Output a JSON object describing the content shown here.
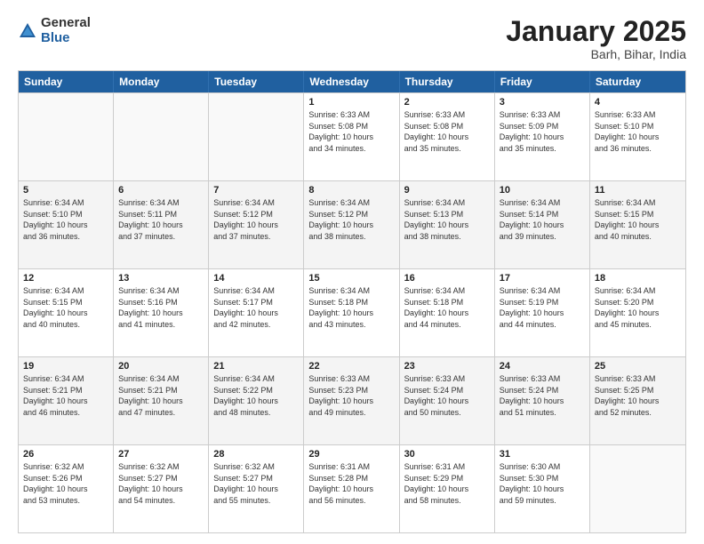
{
  "logo": {
    "general": "General",
    "blue": "Blue"
  },
  "header": {
    "title": "January 2025",
    "location": "Barh, Bihar, India"
  },
  "weekdays": [
    "Sunday",
    "Monday",
    "Tuesday",
    "Wednesday",
    "Thursday",
    "Friday",
    "Saturday"
  ],
  "weeks": [
    [
      {
        "day": "",
        "info": ""
      },
      {
        "day": "",
        "info": ""
      },
      {
        "day": "",
        "info": ""
      },
      {
        "day": "1",
        "info": "Sunrise: 6:33 AM\nSunset: 5:08 PM\nDaylight: 10 hours\nand 34 minutes."
      },
      {
        "day": "2",
        "info": "Sunrise: 6:33 AM\nSunset: 5:08 PM\nDaylight: 10 hours\nand 35 minutes."
      },
      {
        "day": "3",
        "info": "Sunrise: 6:33 AM\nSunset: 5:09 PM\nDaylight: 10 hours\nand 35 minutes."
      },
      {
        "day": "4",
        "info": "Sunrise: 6:33 AM\nSunset: 5:10 PM\nDaylight: 10 hours\nand 36 minutes."
      }
    ],
    [
      {
        "day": "5",
        "info": "Sunrise: 6:34 AM\nSunset: 5:10 PM\nDaylight: 10 hours\nand 36 minutes."
      },
      {
        "day": "6",
        "info": "Sunrise: 6:34 AM\nSunset: 5:11 PM\nDaylight: 10 hours\nand 37 minutes."
      },
      {
        "day": "7",
        "info": "Sunrise: 6:34 AM\nSunset: 5:12 PM\nDaylight: 10 hours\nand 37 minutes."
      },
      {
        "day": "8",
        "info": "Sunrise: 6:34 AM\nSunset: 5:12 PM\nDaylight: 10 hours\nand 38 minutes."
      },
      {
        "day": "9",
        "info": "Sunrise: 6:34 AM\nSunset: 5:13 PM\nDaylight: 10 hours\nand 38 minutes."
      },
      {
        "day": "10",
        "info": "Sunrise: 6:34 AM\nSunset: 5:14 PM\nDaylight: 10 hours\nand 39 minutes."
      },
      {
        "day": "11",
        "info": "Sunrise: 6:34 AM\nSunset: 5:15 PM\nDaylight: 10 hours\nand 40 minutes."
      }
    ],
    [
      {
        "day": "12",
        "info": "Sunrise: 6:34 AM\nSunset: 5:15 PM\nDaylight: 10 hours\nand 40 minutes."
      },
      {
        "day": "13",
        "info": "Sunrise: 6:34 AM\nSunset: 5:16 PM\nDaylight: 10 hours\nand 41 minutes."
      },
      {
        "day": "14",
        "info": "Sunrise: 6:34 AM\nSunset: 5:17 PM\nDaylight: 10 hours\nand 42 minutes."
      },
      {
        "day": "15",
        "info": "Sunrise: 6:34 AM\nSunset: 5:18 PM\nDaylight: 10 hours\nand 43 minutes."
      },
      {
        "day": "16",
        "info": "Sunrise: 6:34 AM\nSunset: 5:18 PM\nDaylight: 10 hours\nand 44 minutes."
      },
      {
        "day": "17",
        "info": "Sunrise: 6:34 AM\nSunset: 5:19 PM\nDaylight: 10 hours\nand 44 minutes."
      },
      {
        "day": "18",
        "info": "Sunrise: 6:34 AM\nSunset: 5:20 PM\nDaylight: 10 hours\nand 45 minutes."
      }
    ],
    [
      {
        "day": "19",
        "info": "Sunrise: 6:34 AM\nSunset: 5:21 PM\nDaylight: 10 hours\nand 46 minutes."
      },
      {
        "day": "20",
        "info": "Sunrise: 6:34 AM\nSunset: 5:21 PM\nDaylight: 10 hours\nand 47 minutes."
      },
      {
        "day": "21",
        "info": "Sunrise: 6:34 AM\nSunset: 5:22 PM\nDaylight: 10 hours\nand 48 minutes."
      },
      {
        "day": "22",
        "info": "Sunrise: 6:33 AM\nSunset: 5:23 PM\nDaylight: 10 hours\nand 49 minutes."
      },
      {
        "day": "23",
        "info": "Sunrise: 6:33 AM\nSunset: 5:24 PM\nDaylight: 10 hours\nand 50 minutes."
      },
      {
        "day": "24",
        "info": "Sunrise: 6:33 AM\nSunset: 5:24 PM\nDaylight: 10 hours\nand 51 minutes."
      },
      {
        "day": "25",
        "info": "Sunrise: 6:33 AM\nSunset: 5:25 PM\nDaylight: 10 hours\nand 52 minutes."
      }
    ],
    [
      {
        "day": "26",
        "info": "Sunrise: 6:32 AM\nSunset: 5:26 PM\nDaylight: 10 hours\nand 53 minutes."
      },
      {
        "day": "27",
        "info": "Sunrise: 6:32 AM\nSunset: 5:27 PM\nDaylight: 10 hours\nand 54 minutes."
      },
      {
        "day": "28",
        "info": "Sunrise: 6:32 AM\nSunset: 5:27 PM\nDaylight: 10 hours\nand 55 minutes."
      },
      {
        "day": "29",
        "info": "Sunrise: 6:31 AM\nSunset: 5:28 PM\nDaylight: 10 hours\nand 56 minutes."
      },
      {
        "day": "30",
        "info": "Sunrise: 6:31 AM\nSunset: 5:29 PM\nDaylight: 10 hours\nand 58 minutes."
      },
      {
        "day": "31",
        "info": "Sunrise: 6:30 AM\nSunset: 5:30 PM\nDaylight: 10 hours\nand 59 minutes."
      },
      {
        "day": "",
        "info": ""
      }
    ]
  ]
}
